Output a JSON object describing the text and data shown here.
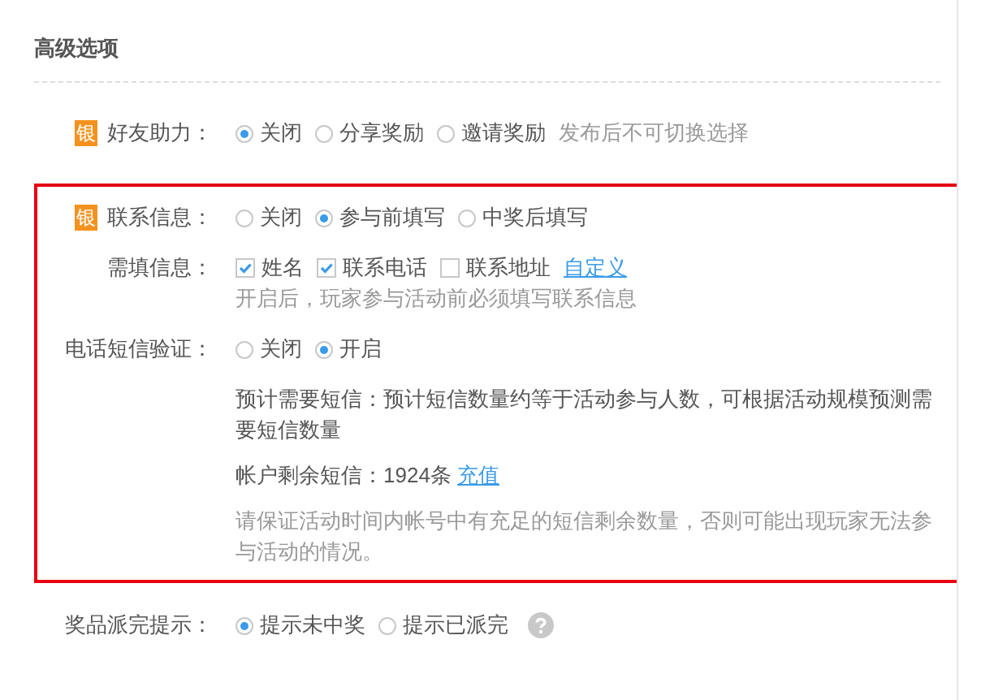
{
  "section_title": "高级选项",
  "friend_help": {
    "kind": "radio",
    "badge": "银",
    "label": "好友助力：",
    "options": [
      {
        "label": "关闭",
        "selected": true
      },
      {
        "label": "分享奖励",
        "selected": false
      },
      {
        "label": "邀请奖励",
        "selected": false
      }
    ],
    "note": "发布后不可切换选择"
  },
  "highlighted_group": {
    "rows": [
      {
        "kind": "radio",
        "badge": "银",
        "label": "联系信息：",
        "options": [
          {
            "label": "关闭",
            "selected": false
          },
          {
            "label": "参与前填写",
            "selected": true
          },
          {
            "label": "中奖后填写",
            "selected": false
          }
        ]
      },
      {
        "kind": "checkbox",
        "label": "需填信息：",
        "options": [
          {
            "label": "姓名",
            "checked": true
          },
          {
            "label": "联系电话",
            "checked": true
          },
          {
            "label": "联系地址",
            "checked": false
          }
        ],
        "link": "自定义",
        "hint": "开启后，玩家参与活动前必须填写联系信息"
      },
      {
        "kind": "radio",
        "label": "电话短信验证：",
        "options": [
          {
            "label": "关闭",
            "selected": false
          },
          {
            "label": "开启",
            "selected": true
          }
        ],
        "details": [
          {
            "kind": "text",
            "text": "预计需要短信：预计短信数量约等于活动参与人数，可根据活动规模预测需要短信数量"
          },
          {
            "kind": "text",
            "text": "帐户剩余短信：1924条",
            "link": "充值"
          },
          {
            "kind": "hint",
            "text": "请保证活动时间内帐号中有充足的短信剩余数量，否则可能出现玩家无法参与活动的情况。"
          }
        ]
      }
    ]
  },
  "prize_hint": {
    "kind": "radio",
    "label": "奖品派完提示：",
    "options": [
      {
        "label": "提示未中奖",
        "selected": true
      },
      {
        "label": "提示已派完",
        "selected": false
      }
    ],
    "help": true
  }
}
